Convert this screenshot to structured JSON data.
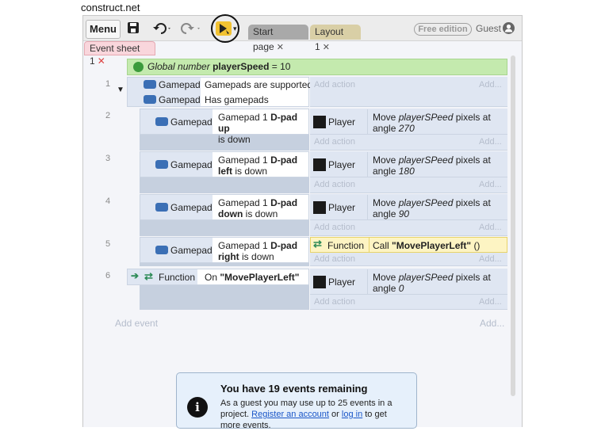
{
  "site_title": "construct.net",
  "toolbar": {
    "menu_label": "Menu",
    "save_icon": "save-icon",
    "undo_icon": "undo-icon",
    "redo_icon": "redo-icon",
    "preview_icon": "play-icon",
    "tabs": [
      {
        "label": "Start page"
      },
      {
        "label": "Layout 1"
      }
    ],
    "free_badge": "Free edition",
    "user": "Guest"
  },
  "document_tab": {
    "label": "Event sheet 1"
  },
  "global_var": {
    "prefix": "Global number",
    "name": "playerSpeed",
    "suffix": "= 10"
  },
  "events": [
    {
      "num": "1",
      "conditions": [
        {
          "object": "Gamepad",
          "text": "Gamepads are supported"
        },
        {
          "object": "Gamepad",
          "text": "Has gamepads"
        }
      ],
      "add_action": "Add action",
      "add": "Add..."
    },
    {
      "num": "2",
      "condition": {
        "object": "Gamepad",
        "t1": "Gamepad 1",
        "b1": "D-pad up",
        "t2": "is down"
      },
      "action": {
        "object": "Player",
        "t1": "Move",
        "i1": "playerSPeed",
        "t2": "pixels at",
        "t3": "angle",
        "i2": "270"
      },
      "add_action": "Add action",
      "add": "Add..."
    },
    {
      "num": "3",
      "condition": {
        "object": "Gamepad",
        "t1": "Gamepad 1",
        "b1": "D-pad",
        "b2": "left",
        "t2": "is down"
      },
      "action": {
        "object": "Player",
        "t1": "Move",
        "i1": "playerSPeed",
        "t2": "pixels at",
        "t3": "angle",
        "i2": "180"
      },
      "add_action": "Add action",
      "add": "Add..."
    },
    {
      "num": "4",
      "condition": {
        "object": "Gamepad",
        "t1": "Gamepad 1",
        "b1": "D-pad",
        "b2": "down",
        "t2": "is down"
      },
      "action": {
        "object": "Player",
        "t1": "Move",
        "i1": "playerSPeed",
        "t2": "pixels at",
        "t3": "angle",
        "i2": "90"
      },
      "add_action": "Add action",
      "add": "Add..."
    },
    {
      "num": "5",
      "condition": {
        "object": "Gamepad",
        "t1": "Gamepad 1",
        "b1": "D-pad",
        "b2": "right",
        "t2": "is down"
      },
      "action": {
        "object": "Function",
        "t1": "Call",
        "b1": "\"MovePlayerLeft\"",
        "t2": "()"
      },
      "add_action": "Add action",
      "add": "Add..."
    },
    {
      "num": "6",
      "condition": {
        "object": "Function",
        "t1": "On",
        "b1": "\"MovePlayerLeft\""
      },
      "action": {
        "object": "Player",
        "t1": "Move",
        "i1": "playerSPeed",
        "t2": "pixels at",
        "t3": "angle",
        "i2": "0"
      },
      "add_action": "Add action",
      "add": "Add..."
    }
  ],
  "add_event": "Add event",
  "add_event_add": "Add...",
  "info": {
    "title": "You have 19 events remaining",
    "line1": "As a guest you may use up to 25 events in a",
    "line2_pre": "project.",
    "link1": "Register an account",
    "or": "or",
    "link2": "log in",
    "line2_post": "to get",
    "line3": "more events.",
    "icon": "info-icon"
  }
}
